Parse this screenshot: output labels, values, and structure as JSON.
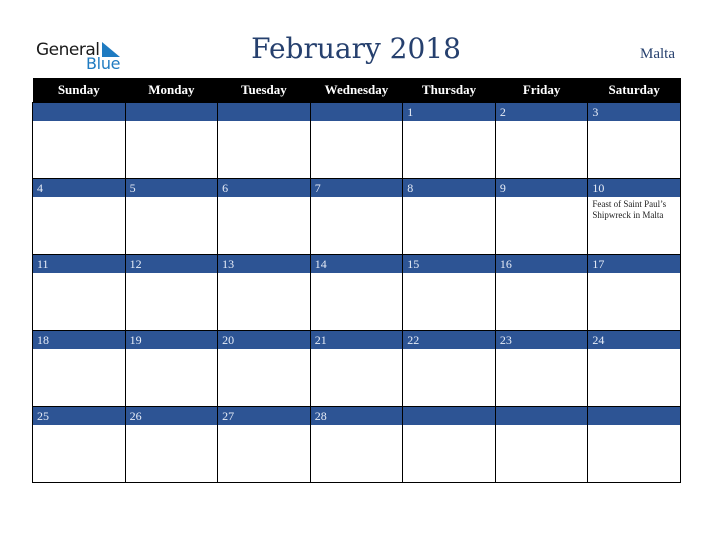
{
  "logo": {
    "line1": "General",
    "line2": "Blue"
  },
  "title": "February 2018",
  "country": "Malta",
  "colors": {
    "header_bg": "#000000",
    "day_bar": "#2d5494",
    "title": "#26406e",
    "logo_blue": "#1f7bc1"
  },
  "weekdays": [
    "Sunday",
    "Monday",
    "Tuesday",
    "Wednesday",
    "Thursday",
    "Friday",
    "Saturday"
  ],
  "weeks": [
    [
      {
        "day": ""
      },
      {
        "day": ""
      },
      {
        "day": ""
      },
      {
        "day": ""
      },
      {
        "day": "1"
      },
      {
        "day": "2"
      },
      {
        "day": "3"
      }
    ],
    [
      {
        "day": "4"
      },
      {
        "day": "5"
      },
      {
        "day": "6"
      },
      {
        "day": "7"
      },
      {
        "day": "8"
      },
      {
        "day": "9"
      },
      {
        "day": "10",
        "event": "Feast of Saint Paul’s Shipwreck in Malta"
      }
    ],
    [
      {
        "day": "11"
      },
      {
        "day": "12"
      },
      {
        "day": "13"
      },
      {
        "day": "14"
      },
      {
        "day": "15"
      },
      {
        "day": "16"
      },
      {
        "day": "17"
      }
    ],
    [
      {
        "day": "18"
      },
      {
        "day": "19"
      },
      {
        "day": "20"
      },
      {
        "day": "21"
      },
      {
        "day": "22"
      },
      {
        "day": "23"
      },
      {
        "day": "24"
      }
    ],
    [
      {
        "day": "25"
      },
      {
        "day": "26"
      },
      {
        "day": "27"
      },
      {
        "day": "28"
      },
      {
        "day": ""
      },
      {
        "day": ""
      },
      {
        "day": ""
      }
    ]
  ]
}
